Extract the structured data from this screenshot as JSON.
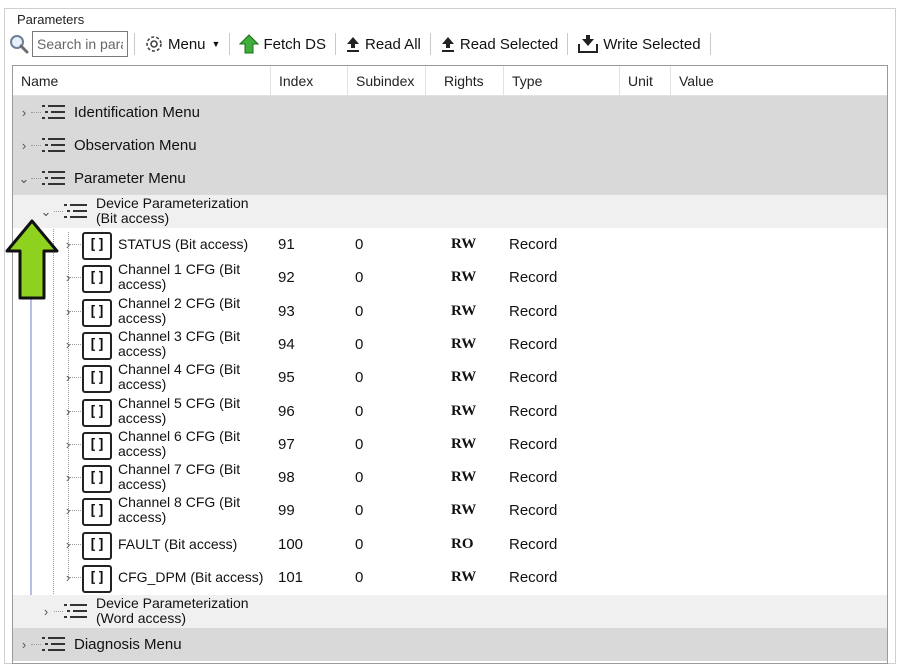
{
  "group_title": "Parameters",
  "toolbar": {
    "search_placeholder": "Search in parameters",
    "menu_label": "Menu",
    "menu_caret": "▼",
    "fetch_ds_label": "Fetch DS",
    "read_all_label": "Read All",
    "read_selected_label": "Read Selected",
    "write_selected_label": "Write Selected"
  },
  "columns": {
    "name": "Name",
    "index": "Index",
    "subindex": "Subindex",
    "rights": "Rights",
    "type": "Type",
    "unit": "Unit",
    "value": "Value"
  },
  "menus": {
    "identification": "Identification Menu",
    "observation": "Observation Menu",
    "parameter": "Parameter Menu",
    "diagnosis": "Diagnosis Menu"
  },
  "submenus": {
    "bit_access": {
      "line1": "Device Parameterization",
      "line2": "(Bit access)"
    },
    "word_access": {
      "line1": "Device Parameterization",
      "line2": "(Word access)"
    }
  },
  "records": [
    {
      "name1": "STATUS (Bit access)",
      "name2": "",
      "index": "91",
      "subindex": "0",
      "rights": "RW",
      "type": "Record"
    },
    {
      "name1": "Channel 1 CFG (Bit",
      "name2": "access)",
      "index": "92",
      "subindex": "0",
      "rights": "RW",
      "type": "Record"
    },
    {
      "name1": "Channel 2 CFG (Bit",
      "name2": "access)",
      "index": "93",
      "subindex": "0",
      "rights": "RW",
      "type": "Record"
    },
    {
      "name1": "Channel 3 CFG (Bit",
      "name2": "access)",
      "index": "94",
      "subindex": "0",
      "rights": "RW",
      "type": "Record"
    },
    {
      "name1": "Channel 4 CFG (Bit",
      "name2": "access)",
      "index": "95",
      "subindex": "0",
      "rights": "RW",
      "type": "Record"
    },
    {
      "name1": "Channel 5 CFG (Bit",
      "name2": "access)",
      "index": "96",
      "subindex": "0",
      "rights": "RW",
      "type": "Record"
    },
    {
      "name1": "Channel 6 CFG (Bit",
      "name2": "access)",
      "index": "97",
      "subindex": "0",
      "rights": "RW",
      "type": "Record"
    },
    {
      "name1": "Channel 7 CFG (Bit",
      "name2": "access)",
      "index": "98",
      "subindex": "0",
      "rights": "RW",
      "type": "Record"
    },
    {
      "name1": "Channel 8 CFG (Bit",
      "name2": "access)",
      "index": "99",
      "subindex": "0",
      "rights": "RW",
      "type": "Record"
    },
    {
      "name1": "FAULT (Bit access)",
      "name2": "",
      "index": "100",
      "subindex": "0",
      "rights": "RO",
      "type": "Record"
    },
    {
      "name1": "CFG_DPM (Bit access)",
      "name2": "",
      "index": "101",
      "subindex": "0",
      "rights": "RW",
      "type": "Record"
    }
  ],
  "icons": {
    "search": "magnifier-icon",
    "menu": "gear-icon",
    "fetch": "green-up-arrow-icon",
    "read": "upload-arrow-icon",
    "write": "download-tray-icon",
    "list": "list-icon",
    "record": "record-brackets-icon",
    "pointer": "green-up-arrow-annotation"
  },
  "record_icon_glyph": "[]",
  "expander_collapsed": "›",
  "expander_expanded": "⌄",
  "colors": {
    "menu_row_bg": "#d9d9d9",
    "submenu_row_bg": "#f0f0f0",
    "arrow_green": "#8ed11e"
  }
}
